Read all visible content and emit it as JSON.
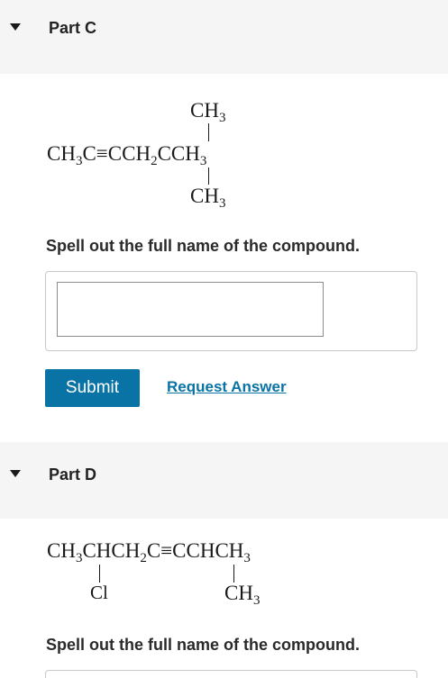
{
  "partC": {
    "title": "Part C",
    "structure": {
      "top_substituent": "CH",
      "top_substituent_sub": "3",
      "main_chain": [
        "CH",
        "3",
        "C≡CCH",
        "2",
        "CCH",
        "3"
      ],
      "bottom_substituent": "CH",
      "bottom_substituent_sub": "3"
    },
    "prompt": "Spell out the full name of the compound.",
    "input_value": "",
    "submit_label": "Submit",
    "request_answer_label": "Request Answer"
  },
  "partD": {
    "title": "Part D",
    "structure": {
      "main_chain": [
        "CH",
        "3",
        "CHCH",
        "2",
        "C≡CCHCH",
        "3"
      ],
      "substituent_left": "Cl",
      "substituent_right": "CH",
      "substituent_right_sub": "3"
    },
    "prompt": "Spell out the full name of the compound."
  },
  "icons": {
    "caret": "caret-down-icon"
  },
  "colors": {
    "accent": "#0a73a5",
    "header_bg": "#f5f5f5"
  }
}
